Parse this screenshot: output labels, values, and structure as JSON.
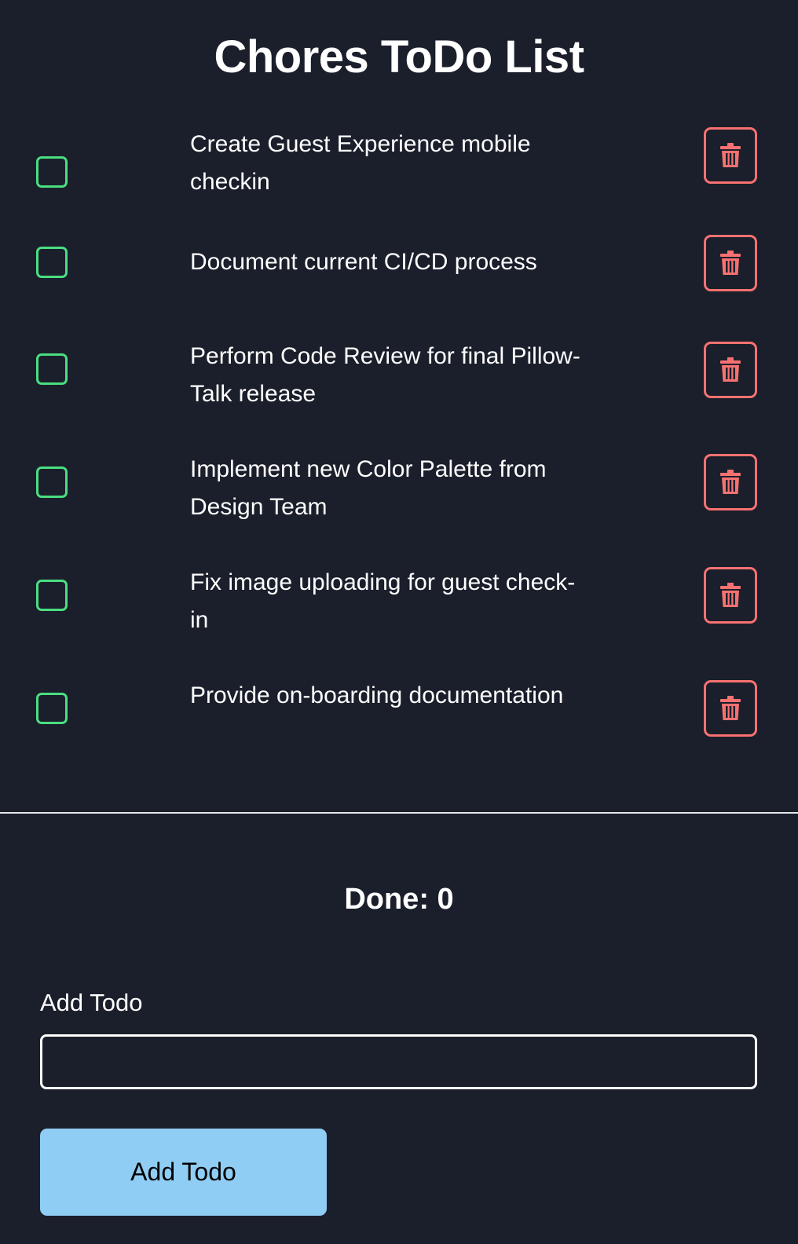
{
  "title": "Chores ToDo List",
  "todos": [
    {
      "text": "Create Guest Experience mobile checkin",
      "checked": false
    },
    {
      "text": "Document current CI/CD process",
      "checked": false
    },
    {
      "text": "Perform Code Review for final Pillow-Talk release",
      "checked": false
    },
    {
      "text": "Implement new Color Palette from Design Team",
      "checked": false
    },
    {
      "text": "Fix image uploading for guest check-in",
      "checked": false
    },
    {
      "text": "Provide on-boarding documentation",
      "checked": false
    }
  ],
  "done": {
    "label": "Done:",
    "count": "0"
  },
  "add_form": {
    "label": "Add Todo",
    "input_value": "",
    "button_label": "Add Todo"
  },
  "icons": {
    "checkbox": "checkbox-icon",
    "delete": "trash-icon"
  },
  "colors": {
    "background": "#1b1f2b",
    "checkbox_border": "#4ade80",
    "delete_border": "#f87171",
    "button_bg": "#90cdf4",
    "text": "#ffffff"
  }
}
